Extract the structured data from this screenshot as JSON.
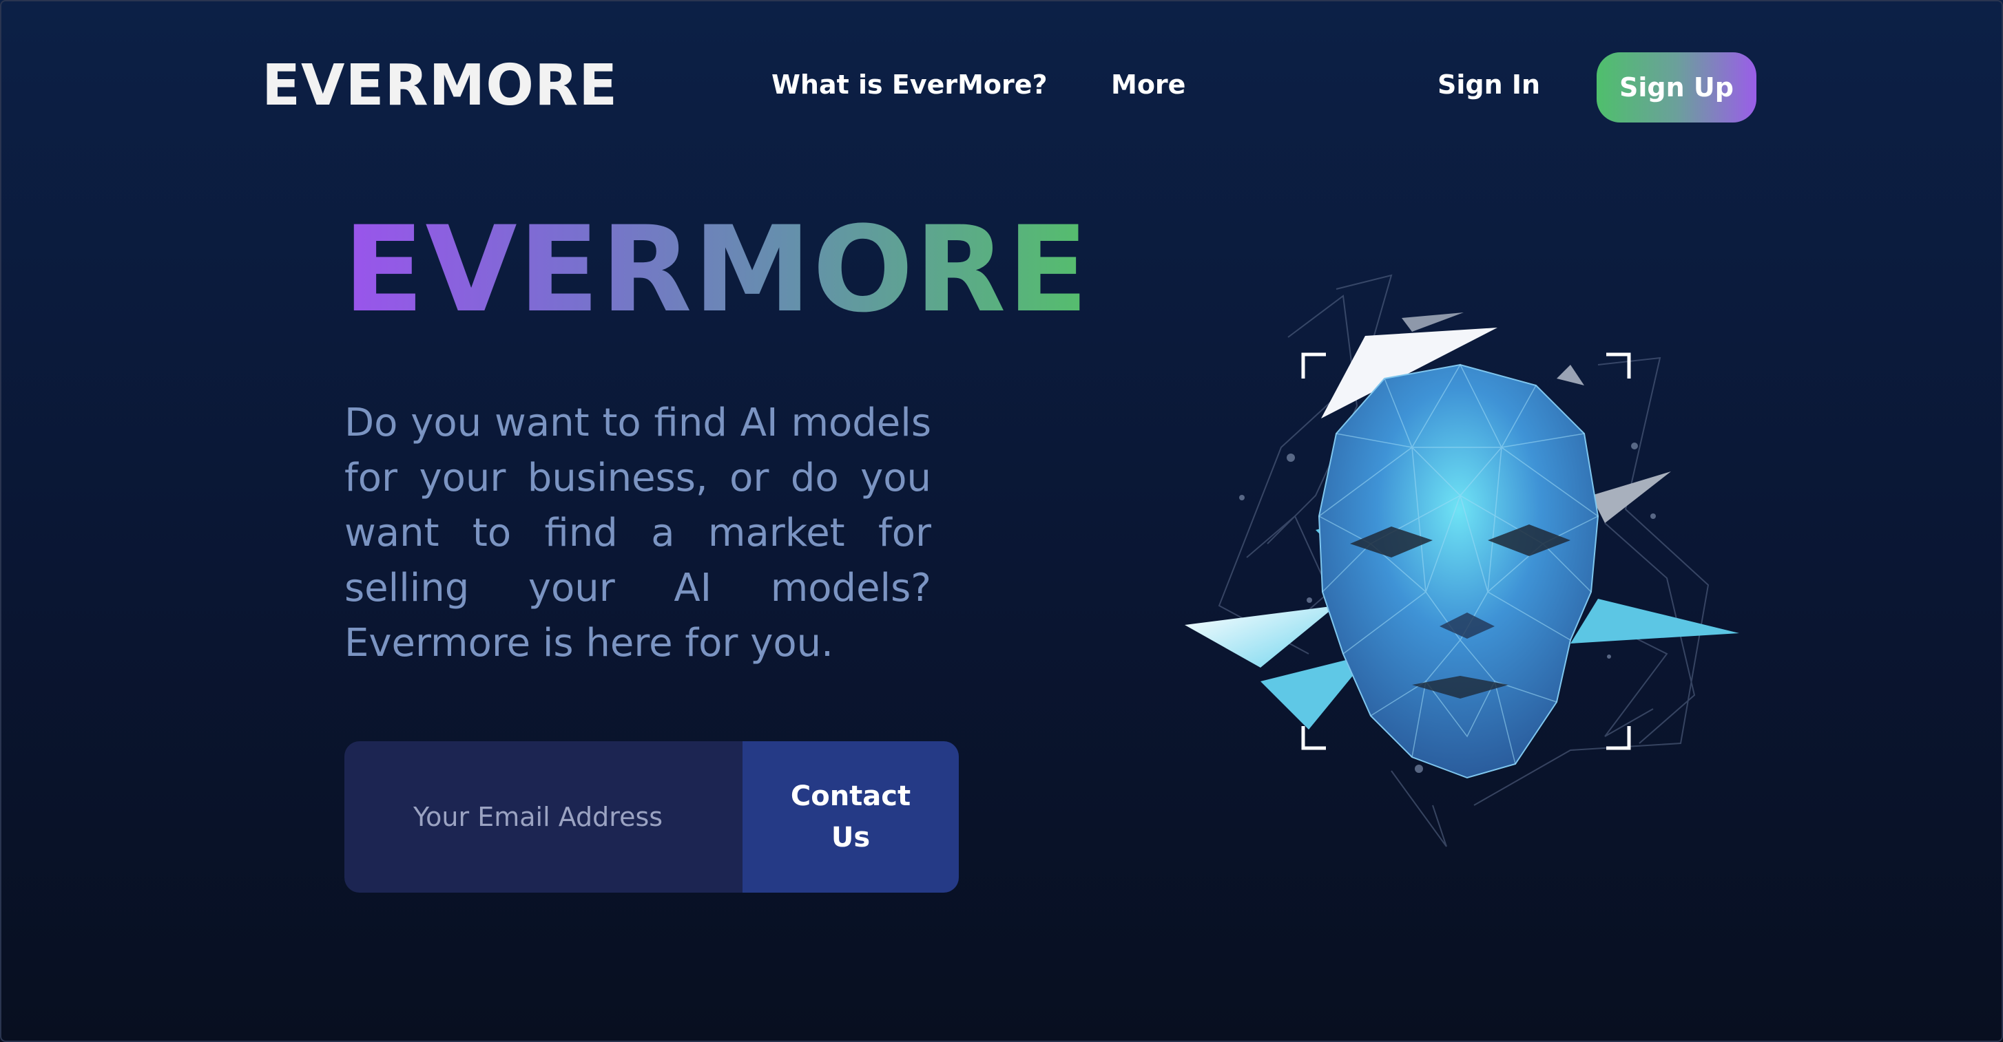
{
  "nav": {
    "logo": "EVERMORE",
    "links": [
      {
        "label": "What is EverMore?"
      },
      {
        "label": "More"
      }
    ],
    "sign_in": "Sign In",
    "sign_up": "Sign Up"
  },
  "hero": {
    "title": "EVERMORE",
    "description": "Do you want to find AI models for your business, or do you want to find a market for selling your AI models? Evermore is here for you.",
    "email_placeholder": "Your Email Address",
    "contact_button": "Contact Us"
  },
  "colors": {
    "background_top": "#0c2046",
    "background_bottom": "#080f20",
    "accent_purple": "#9a54ec",
    "accent_green": "#55be6c",
    "description_text": "#7b94c2",
    "input_bg": "#1c2552",
    "button_bg": "#253a86"
  },
  "icons": {
    "hero_illustration": "polygonal-ai-face-icon"
  }
}
